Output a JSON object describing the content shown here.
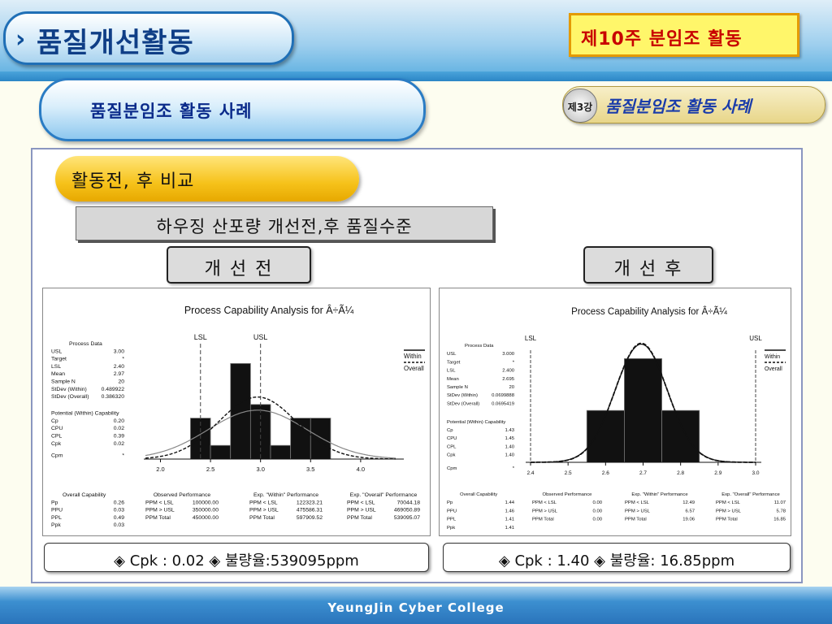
{
  "header": {
    "chevron": "›",
    "title": "품질개선활동",
    "week_label": "제10주  분임조  활동",
    "subtitle": "품질분임조 활동 사례",
    "lecture_badge": "제3강",
    "lecture_title": "품질분임조 활동 사례"
  },
  "section": {
    "compare_title": "활동전, 후 비교",
    "bar_title": "하우징 산포량 개선전,후 품질수준",
    "before_label": "개 선 전",
    "after_label": "개 선 후"
  },
  "results": {
    "before": "◈ Cpk : 0.02  ◈ 불량율:539095ppm",
    "after": "◈ Cpk : 1.40  ◈ 불량율: 16.85ppm"
  },
  "footer": {
    "text": "YeungJin Cyber College"
  },
  "colors": {
    "accent_red": "#c80000",
    "title_blue": "#0f3e86",
    "bar_fill": "#111111"
  },
  "chart_data": [
    {
      "type": "bar",
      "title": "Process Capability Analysis for Â÷Ã¼",
      "spec_labels": [
        "LSL",
        "USL"
      ],
      "lsl": 2.4,
      "usl": 3.0,
      "xlim": [
        1.85,
        4.35
      ],
      "x_ticks": [
        "2.0",
        "2.5",
        "3.0",
        "3.5",
        "4.0"
      ],
      "x_tick_values": [
        2.0,
        2.5,
        3.0,
        3.5,
        4.0
      ],
      "bins": [
        {
          "start": 2.3,
          "end": 2.5,
          "count": 3
        },
        {
          "start": 2.5,
          "end": 2.7,
          "count": 1
        },
        {
          "start": 2.7,
          "end": 2.9,
          "count": 7
        },
        {
          "start": 2.9,
          "end": 3.1,
          "count": 4
        },
        {
          "start": 3.1,
          "end": 3.3,
          "count": 1
        },
        {
          "start": 3.3,
          "end": 3.5,
          "count": 3
        },
        {
          "start": 3.5,
          "end": 3.7,
          "count": 3
        }
      ],
      "ymax": 7.5,
      "mean": 2.97,
      "sd_within": 0.489922,
      "sd_overall": 0.38632,
      "legend": [
        "Within",
        "Overall"
      ],
      "process_data_title": "Process Data",
      "process_data": [
        {
          "label": "USL",
          "value": "3.00"
        },
        {
          "label": "Target",
          "value": "*"
        },
        {
          "label": "LSL",
          "value": "2.40"
        },
        {
          "label": "Mean",
          "value": "2.97"
        },
        {
          "label": "Sample N",
          "value": "20"
        },
        {
          "label": "StDev (Within)",
          "value": "0.489922"
        },
        {
          "label": "StDev (Overall)",
          "value": "0.386320"
        }
      ],
      "potential_title": "Potential (Within) Capability",
      "potential": [
        {
          "label": "Cp",
          "value": "0.20"
        },
        {
          "label": "CPU",
          "value": "0.02"
        },
        {
          "label": "CPL",
          "value": "0.39"
        },
        {
          "label": "Cpk",
          "value": "0.02"
        }
      ],
      "cpm": {
        "label": "Cpm",
        "value": "*"
      },
      "overall_title": "Overall Capability",
      "overall": [
        {
          "label": "Pp",
          "value": "0.26"
        },
        {
          "label": "PPU",
          "value": "0.03"
        },
        {
          "label": "PPL",
          "value": "0.49"
        },
        {
          "label": "Ppk",
          "value": "0.03"
        }
      ],
      "observed_title": "Observed Performance",
      "observed": [
        {
          "label": "PPM < LSL",
          "value": "100000.00"
        },
        {
          "label": "PPM > USL",
          "value": "350000.00"
        },
        {
          "label": "PPM Total",
          "value": "450000.00"
        }
      ],
      "exp_within_title": "Exp. \"Within\" Performance",
      "exp_within": [
        {
          "label": "PPM < LSL",
          "value": "122323.21"
        },
        {
          "label": "PPM > USL",
          "value": "475586.31"
        },
        {
          "label": "PPM Total",
          "value": "597909.52"
        }
      ],
      "exp_overall_title": "Exp. \"Overall\" Performance",
      "exp_overall": [
        {
          "label": "PPM < LSL",
          "value": "70044.18"
        },
        {
          "label": "PPM > USL",
          "value": "469050.89"
        },
        {
          "label": "PPM Total",
          "value": "539095.07"
        }
      ]
    },
    {
      "type": "bar",
      "title": "Process Capability Analysis for Â÷Ã¼",
      "spec_labels": [
        "LSL",
        "USL"
      ],
      "lsl": 2.4,
      "usl": 3.0,
      "xlim": [
        2.4,
        3.0
      ],
      "x_ticks": [
        "2.4",
        "2.5",
        "2.6",
        "2.7",
        "2.8",
        "2.9",
        "3.0"
      ],
      "x_tick_values": [
        2.4,
        2.5,
        2.6,
        2.7,
        2.8,
        2.9,
        3.0
      ],
      "bins": [
        {
          "start": 2.55,
          "end": 2.65,
          "count": 5
        },
        {
          "start": 2.65,
          "end": 2.75,
          "count": 10
        },
        {
          "start": 2.75,
          "end": 2.85,
          "count": 5
        }
      ],
      "ymax": 10.5,
      "mean": 2.695,
      "sd_within": 0.0699888,
      "sd_overall": 0.0695419,
      "legend": [
        "Within",
        "Overall"
      ],
      "process_data_title": "Process Data",
      "process_data": [
        {
          "label": "USL",
          "value": "3.000"
        },
        {
          "label": "Target",
          "value": "*"
        },
        {
          "label": "LSL",
          "value": "2.400"
        },
        {
          "label": "Mean",
          "value": "2.695"
        },
        {
          "label": "Sample N",
          "value": "20"
        },
        {
          "label": "StDev (Within)",
          "value": "0.0699888"
        },
        {
          "label": "StDev (Overall)",
          "value": "0.0695419"
        }
      ],
      "potential_title": "Potential (Within) Capability",
      "potential": [
        {
          "label": "Cp",
          "value": "1.43"
        },
        {
          "label": "CPU",
          "value": "1.45"
        },
        {
          "label": "CPL",
          "value": "1.40"
        },
        {
          "label": "Cpk",
          "value": "1.40"
        }
      ],
      "cpm": {
        "label": "Cpm",
        "value": "*"
      },
      "overall_title": "Overall Capability",
      "overall": [
        {
          "label": "Pp",
          "value": "1.44"
        },
        {
          "label": "PPU",
          "value": "1.46"
        },
        {
          "label": "PPL",
          "value": "1.41"
        },
        {
          "label": "Ppk",
          "value": "1.41"
        }
      ],
      "observed_title": "Observed Performance",
      "observed": [
        {
          "label": "PPM < LSL",
          "value": "0.00"
        },
        {
          "label": "PPM > USL",
          "value": "0.00"
        },
        {
          "label": "PPM Total",
          "value": "0.00"
        }
      ],
      "exp_within_title": "Exp. \"Within\" Performance",
      "exp_within": [
        {
          "label": "PPM < LSL",
          "value": "12.49"
        },
        {
          "label": "PPM > USL",
          "value": "6.57"
        },
        {
          "label": "PPM Total",
          "value": "19.06"
        }
      ],
      "exp_overall_title": "Exp. \"Overall\" Performance",
      "exp_overall": [
        {
          "label": "PPM < LSL",
          "value": "11.07"
        },
        {
          "label": "PPM > USL",
          "value": "5.78"
        },
        {
          "label": "PPM Total",
          "value": "16.85"
        }
      ]
    }
  ]
}
